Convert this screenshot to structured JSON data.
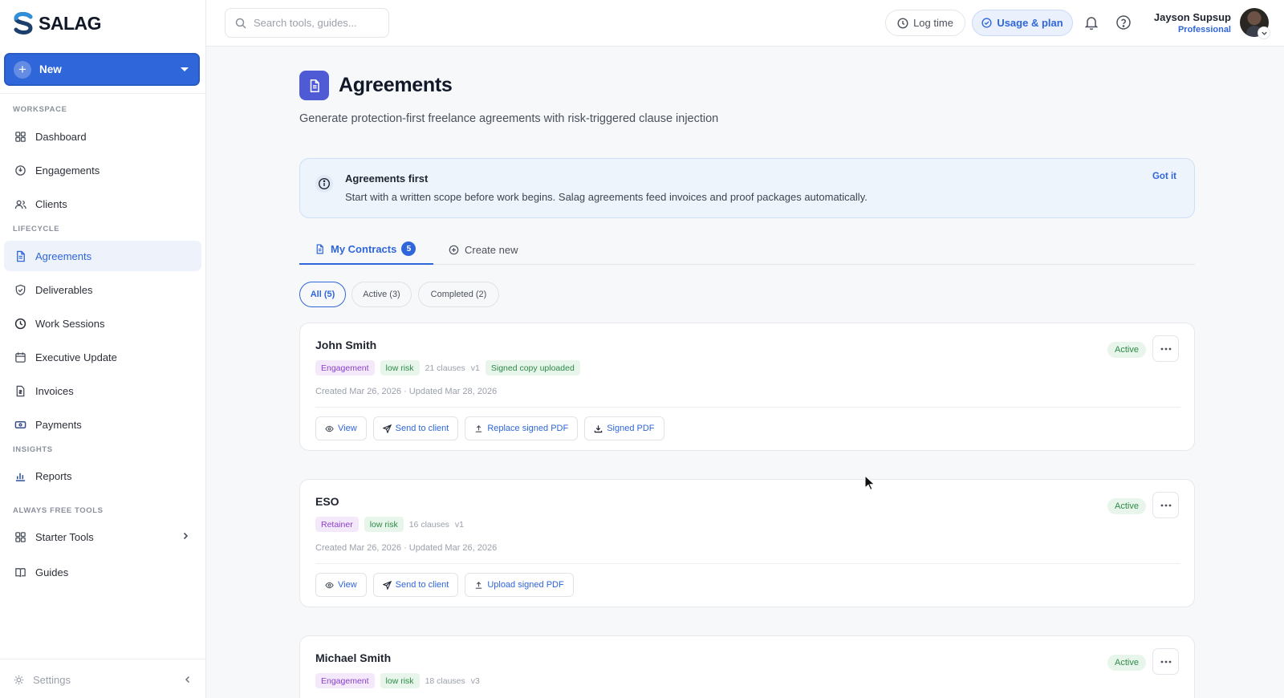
{
  "brand": {
    "name": "SALAG"
  },
  "sidebar": {
    "new_label": "New",
    "sections": {
      "workspace": "WORKSPACE",
      "lifecycle": "LIFECYCLE",
      "insights": "INSIGHTS",
      "free_tools": "ALWAYS FREE TOOLS"
    },
    "items": [
      {
        "label": "Dashboard",
        "icon": "grid-icon"
      },
      {
        "label": "Engagements",
        "icon": "engagement-icon"
      },
      {
        "label": "Clients",
        "icon": "users-icon"
      },
      {
        "label": "Agreements",
        "icon": "document-icon",
        "active": true
      },
      {
        "label": "Deliverables",
        "icon": "shield-check-icon"
      },
      {
        "label": "Work Sessions",
        "icon": "clock-icon"
      },
      {
        "label": "Executive Update",
        "icon": "calendar-icon"
      },
      {
        "label": "Invoices",
        "icon": "invoice-icon"
      },
      {
        "label": "Payments",
        "icon": "card-icon"
      },
      {
        "label": "Reports",
        "icon": "bar-chart-icon"
      },
      {
        "label": "Starter Tools",
        "icon": "grid-icon"
      },
      {
        "label": "Guides",
        "icon": "book-icon"
      }
    ],
    "settings_label": "Settings"
  },
  "topbar": {
    "search_placeholder": "Search tools, guides...",
    "log_time_label": "Log time",
    "usage_label": "Usage & plan",
    "user_name": "Jayson Supsup",
    "user_plan": "Professional"
  },
  "page": {
    "title": "Agreements",
    "subtitle": "Generate protection-first freelance agreements with risk-triggered clause injection"
  },
  "banner": {
    "title": "Agreements first",
    "text": "Start with a written scope before work begins. Salag agreements feed invoices and proof packages automatically.",
    "dismiss_label": "Got it"
  },
  "tabs": {
    "contracts_label": "My Contracts",
    "contracts_count": "5",
    "create_label": "Create new"
  },
  "filters": {
    "all": "All (5)",
    "active": "Active (3)",
    "completed": "Completed (2)"
  },
  "contracts": [
    {
      "name": "John Smith",
      "type": "Engagement",
      "risk": "low risk",
      "clauses": "21 clauses",
      "version": "v1",
      "extra_tag": "Signed copy uploaded",
      "dates": "Created Mar 26, 2026 · Updated Mar 28, 2026",
      "status": "Active",
      "actions": [
        "View",
        "Send to client",
        "Replace signed PDF",
        "Signed PDF"
      ]
    },
    {
      "name": "ESO",
      "type": "Retainer",
      "risk": "low risk",
      "clauses": "16 clauses",
      "version": "v1",
      "dates": "Created Mar 26, 2026 · Updated Mar 26, 2026",
      "status": "Active",
      "actions": [
        "View",
        "Send to client",
        "Upload signed PDF"
      ]
    },
    {
      "name": "Michael Smith",
      "type": "Engagement",
      "risk": "low risk",
      "clauses": "18 clauses",
      "version": "v3",
      "status": "Active"
    }
  ],
  "colors": {
    "accent": "#2f66d9",
    "title_icon_bg": "#4f5bd5",
    "status_green": "#2e8a48",
    "chip_purple": "#8a3fc7"
  }
}
